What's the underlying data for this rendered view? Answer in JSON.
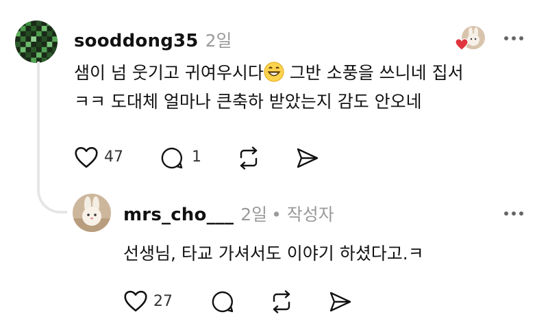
{
  "comment": {
    "username": "sooddong35",
    "time": "2일",
    "text_line1": "샘이 넘 웃기고 귀여우시다",
    "text_line1_after_emoji": " 그반 소풍을 쓰니네 집서",
    "text_line2": "ㅋㅋ 도대체 얼마나 큰축하 받았는지 감도 안오네",
    "like_count": "47",
    "reply_count": "1",
    "icons": [
      "more-options-icon",
      "heart-icon",
      "comment-icon",
      "repost-icon",
      "share-icon"
    ]
  },
  "reply": {
    "username": "mrs_cho___",
    "time": "2일",
    "author_badge": "• 작성자",
    "text": "선생님, 타교 가셔서도 이야기 하셨다고.ㅋ",
    "like_count": "27",
    "icons": [
      "more-options-icon",
      "heart-icon",
      "comment-icon",
      "repost-icon",
      "share-icon"
    ]
  },
  "colors": {
    "liked_heart": "#e0353f",
    "meta": "#9a9a9a",
    "thread_line": "#e6e6e6"
  }
}
